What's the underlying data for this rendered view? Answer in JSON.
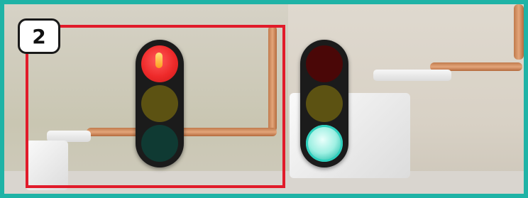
{
  "badge": {
    "number": "2"
  },
  "colors": {
    "frame": "#1fb3a6",
    "highlight_box": "#e11b2a",
    "red_lamp_on": "#ee2a2a",
    "green_lamp_on": "#9ff0e3"
  },
  "traffic_lights": [
    {
      "name": "left",
      "active": "red"
    },
    {
      "name": "right",
      "active": "green"
    }
  ]
}
